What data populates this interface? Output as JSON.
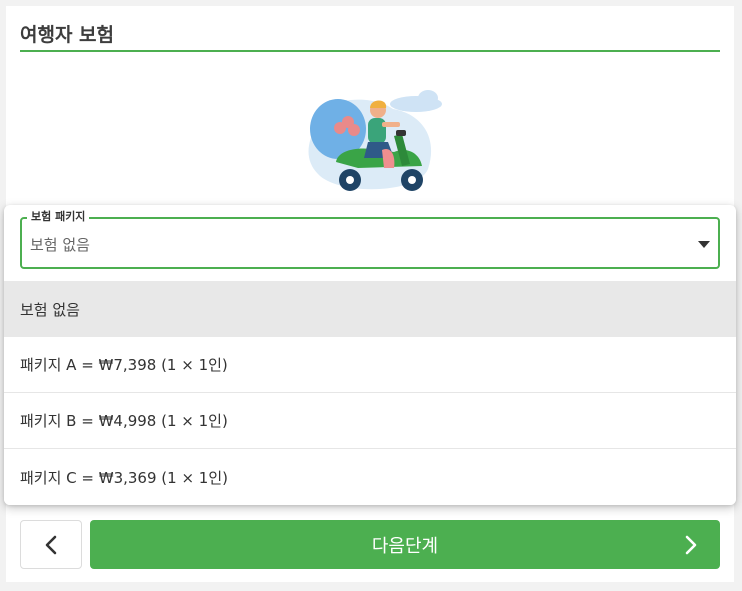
{
  "section": {
    "title": "여행자 보험"
  },
  "select": {
    "legend": "보험 패키지",
    "value": "보험 없음",
    "options": [
      {
        "label": "보험 없음",
        "selected": true
      },
      {
        "label": "패키지 A = ₩7,398 (1 × 1인)",
        "selected": false
      },
      {
        "label": "패키지 B = ₩4,998 (1 × 1인)",
        "selected": false
      },
      {
        "label": "패키지 C = ₩3,369 (1 × 1인)",
        "selected": false
      }
    ]
  },
  "footer": {
    "back_icon": "chevron-left-icon",
    "next_label": "다음단계",
    "next_icon": "chevron-right-icon"
  },
  "colors": {
    "accent": "#4caf50",
    "selected_option_bg": "#e8e8e8",
    "page_bg": "#f2f2f2"
  }
}
